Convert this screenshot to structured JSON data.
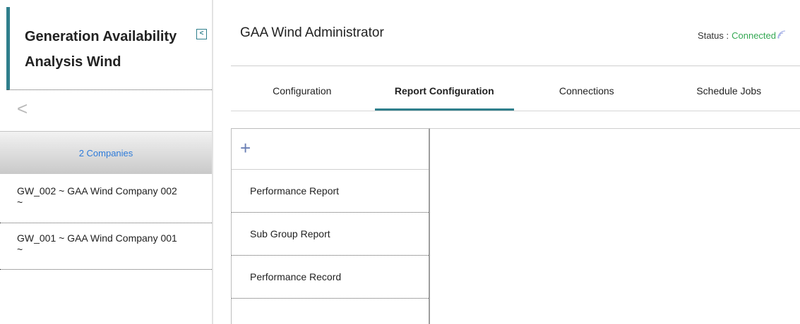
{
  "sidebar": {
    "app_title": "Generation Availability Analysis Wind",
    "collapse_glyph": "<",
    "back_glyph": "<",
    "companies_label": "2 Companies",
    "companies": [
      {
        "label": "GW_002 ~ GAA Wind Company 002 ~"
      },
      {
        "label": "GW_001 ~ GAA Wind Company 001 ~"
      }
    ]
  },
  "header": {
    "title": "GAA Wind Administrator",
    "status_label": "Status :",
    "status_value": "Connected",
    "status_color": "#34a853"
  },
  "tabs": [
    {
      "label": "Configuration",
      "active": false
    },
    {
      "label": "Report Configuration",
      "active": true
    },
    {
      "label": "Connections",
      "active": false
    },
    {
      "label": "Schedule Jobs",
      "active": false
    }
  ],
  "reports": {
    "add_glyph": "+",
    "items": [
      {
        "label": "Performance Report"
      },
      {
        "label": "Sub Group Report"
      },
      {
        "label": "Performance Record"
      }
    ]
  },
  "colors": {
    "accent": "#2f7f8c",
    "link": "#2e7bd9"
  },
  "icons": {
    "collapse": "collapse-icon",
    "back": "chevron-left-icon",
    "add": "plus-icon",
    "wifi": "wifi-icon"
  }
}
